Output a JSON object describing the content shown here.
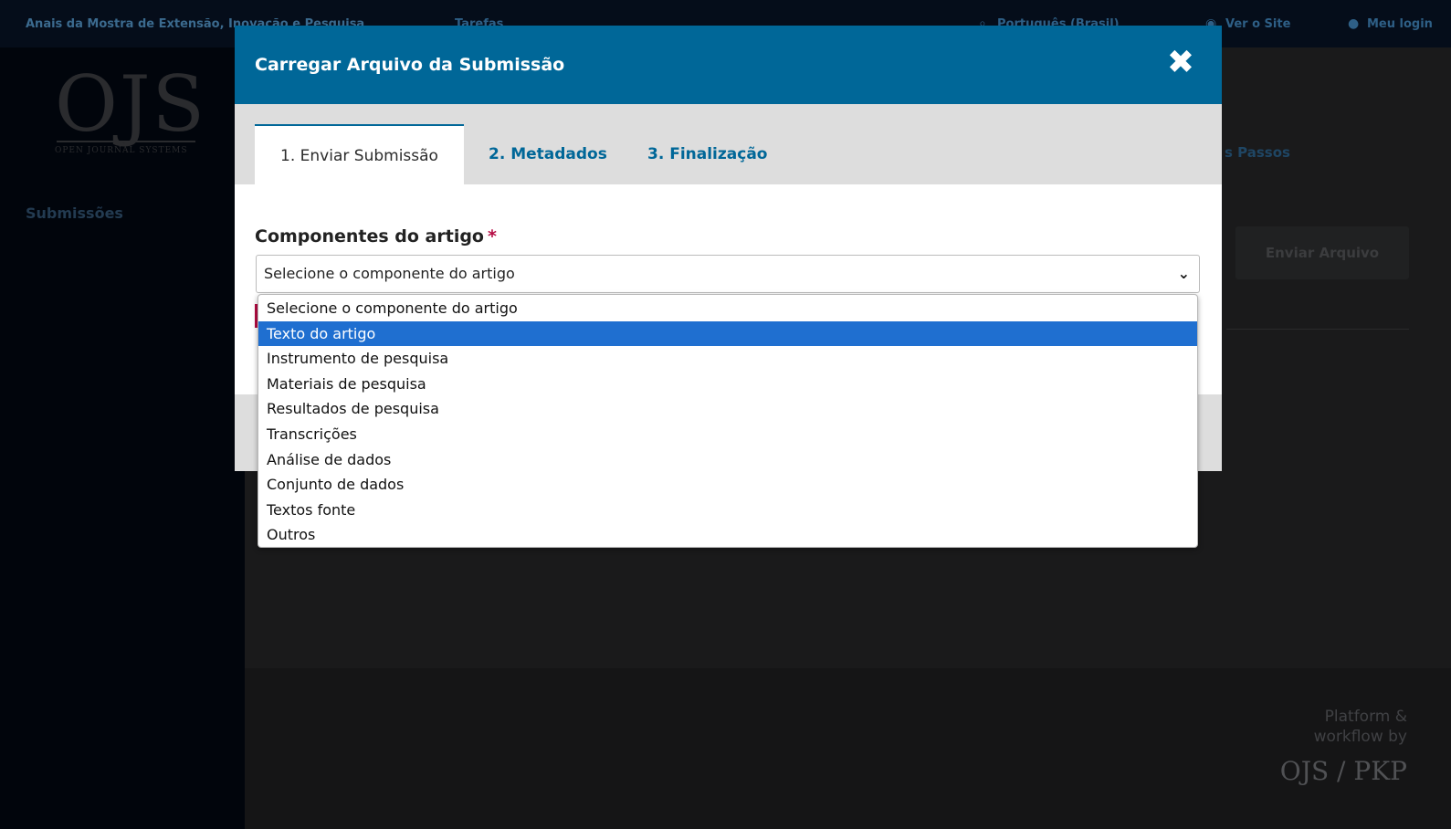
{
  "topbar": {
    "site_title": "Anais da Mostra de Extensão, Inovação e Pesquisa",
    "tasks_label": "Tarefas",
    "language_label": "Português (Brasil)",
    "view_site_label": "Ver o Site",
    "login_label": "Meu login"
  },
  "sidebar": {
    "logo_text": "OJS",
    "logo_subtext": "OPEN JOURNAL SYSTEMS",
    "nav_item": "Submissões"
  },
  "background": {
    "next_steps_label": "s Passos",
    "upload_button_label": "Enviar Arquivo"
  },
  "modal": {
    "title": "Carregar Arquivo da Submissão",
    "tabs": [
      {
        "label": "1. Enviar Submissão"
      },
      {
        "label": "2. Metadados"
      },
      {
        "label": "3. Finalização"
      }
    ],
    "field_label": "Componentes do artigo",
    "required_mark": "*",
    "select_value": "Selecione o componente do artigo",
    "options": [
      "Selecione o componente do artigo",
      "Texto do artigo",
      "Instrumento de pesquisa",
      "Materiais de pesquisa",
      "Resultados de pesquisa",
      "Transcrições",
      "Análise de dados",
      "Conjunto de dados",
      "Textos fonte",
      "Outros"
    ],
    "highlighted_option": "Texto do artigo"
  },
  "footer": {
    "platform_line1": "Platform &",
    "platform_line2": "workflow by",
    "platform_brand": "OJS / PKP"
  },
  "colors": {
    "brand_blue": "#006798",
    "highlight_blue": "#1f6fd0",
    "required_red": "#b50b43"
  }
}
